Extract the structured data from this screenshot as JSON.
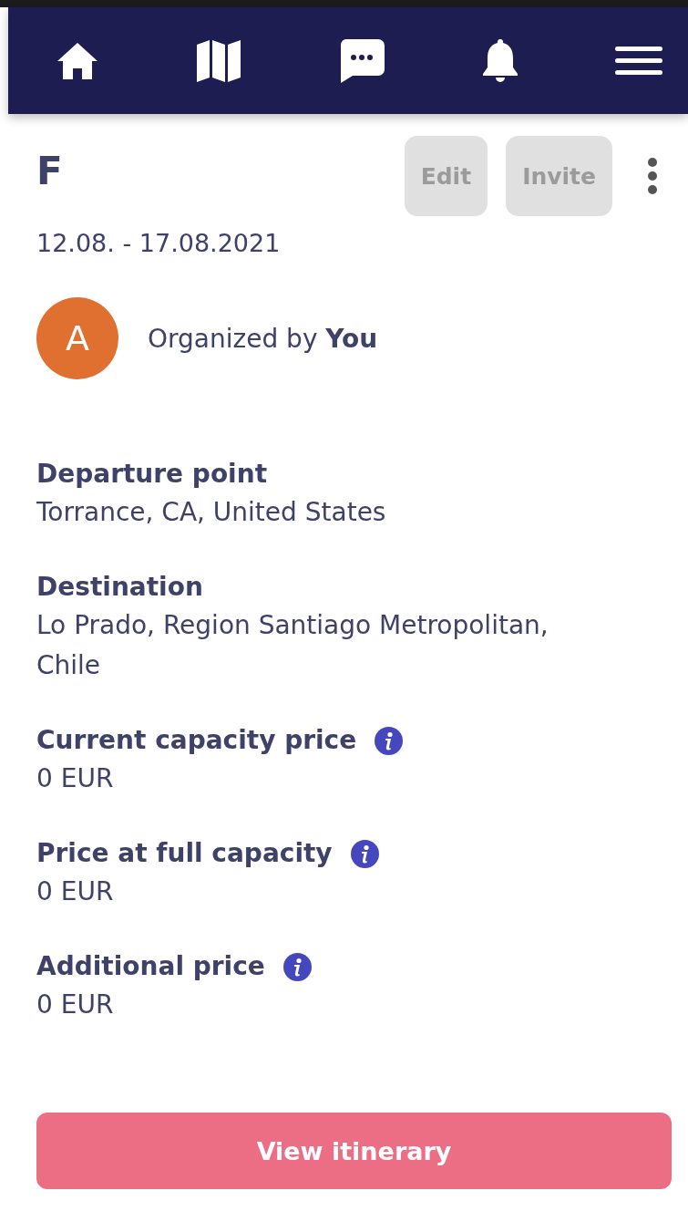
{
  "nav": [
    {
      "kind": "home",
      "selected": false
    },
    {
      "kind": "map",
      "selected": false
    },
    {
      "kind": "chat",
      "selected": false
    },
    {
      "kind": "bell",
      "selected": false
    },
    {
      "kind": "menu",
      "selected": false
    }
  ],
  "trip": {
    "title": "F",
    "dates": "12.08. - 17.08.2021"
  },
  "actions": [
    {
      "label": "Edit",
      "disabled": true
    },
    {
      "label": "Invite",
      "disabled": true
    }
  ],
  "organizer": {
    "initial": "A",
    "color": "#e07030",
    "text": "Organized by **You**"
  },
  "fields": [
    {
      "label": "Departure point",
      "value": "Torrance, CA, United States",
      "info": false
    },
    {
      "label": "Destination",
      "value": "Lo Prado, Region Santiago Metropolitan, Chile",
      "info": false
    },
    {
      "label": "Current capacity price",
      "value": "0 EUR",
      "info": true
    },
    {
      "label": "Price at full capacity",
      "value": "0 EUR",
      "info": true
    },
    {
      "label": "Additional price",
      "value": "0 EUR",
      "info": true
    }
  ],
  "primary_button": {
    "label": "View itinerary"
  }
}
